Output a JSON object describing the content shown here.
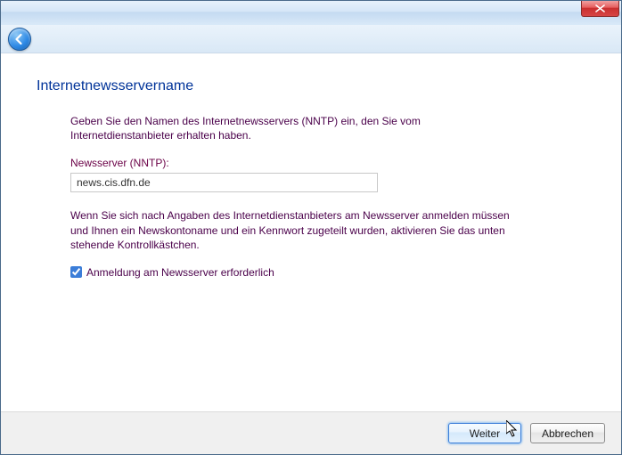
{
  "page": {
    "title": "Internetnewsservername",
    "intro": "Geben Sie den Namen des Internetnewsservers (NNTP) ein, den Sie vom Internetdienstanbieter erhalten haben.",
    "fieldLabel": "Newsserver (NNTP):",
    "fieldValue": "news.cis.dfn.de",
    "note": "Wenn Sie sich nach Angaben des Internetdienstanbieters am Newsserver anmelden müssen und Ihnen ein Newskontoname und ein Kennwort zugeteilt wurden, aktivieren Sie das unten stehende Kontrollkästchen.",
    "checkboxLabel": "Anmeldung am Newsserver erforderlich",
    "checkboxChecked": true
  },
  "buttons": {
    "next": "Weiter",
    "cancel": "Abbrechen"
  }
}
